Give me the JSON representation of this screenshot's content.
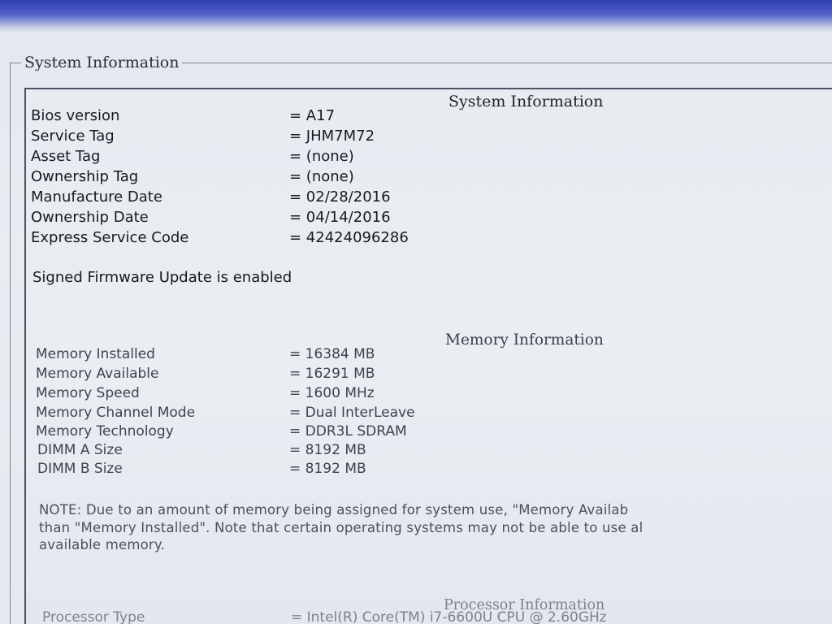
{
  "group_title": "System Information",
  "system": {
    "heading": "System Information",
    "rows": [
      {
        "label": "Bios version",
        "value": "= A17"
      },
      {
        "label": "Service Tag",
        "value": "= JHM7M72"
      },
      {
        "label": "Asset Tag",
        "value": "= (none)"
      },
      {
        "label": "Ownership Tag",
        "value": "= (none)"
      },
      {
        "label": "Manufacture Date",
        "value": "= 02/28/2016"
      },
      {
        "label": "Ownership Date",
        "value": "= 04/14/2016"
      },
      {
        "label": "Express Service Code",
        "value": "= 42424096286"
      }
    ],
    "firmware_status": "Signed Firmware Update is enabled"
  },
  "memory": {
    "heading": "Memory Information",
    "rows": [
      {
        "label": "Memory Installed",
        "value": "= 16384 MB"
      },
      {
        "label": "Memory Available",
        "value": "= 16291 MB"
      },
      {
        "label": "Memory Speed",
        "value": "= 1600 MHz"
      },
      {
        "label": "Memory Channel Mode",
        "value": "= Dual InterLeave"
      },
      {
        "label": "Memory Technology",
        "value": "= DDR3L SDRAM"
      },
      {
        "label": "DIMM A Size",
        "value": "= 8192 MB"
      },
      {
        "label": "DIMM B Size",
        "value": "= 8192 MB"
      }
    ],
    "note_lines": [
      "NOTE: Due to an amount of memory being assigned for system use, \"Memory Availab",
      "than \"Memory Installed\". Note that certain operating systems may not be able to use al",
      "available memory."
    ]
  },
  "processor": {
    "heading": "Processor Information",
    "rows": [
      {
        "label": "Processor Type",
        "value": "= Intel(R) Core(TM) i7-6600U CPU @ 2.60GHz"
      }
    ]
  }
}
